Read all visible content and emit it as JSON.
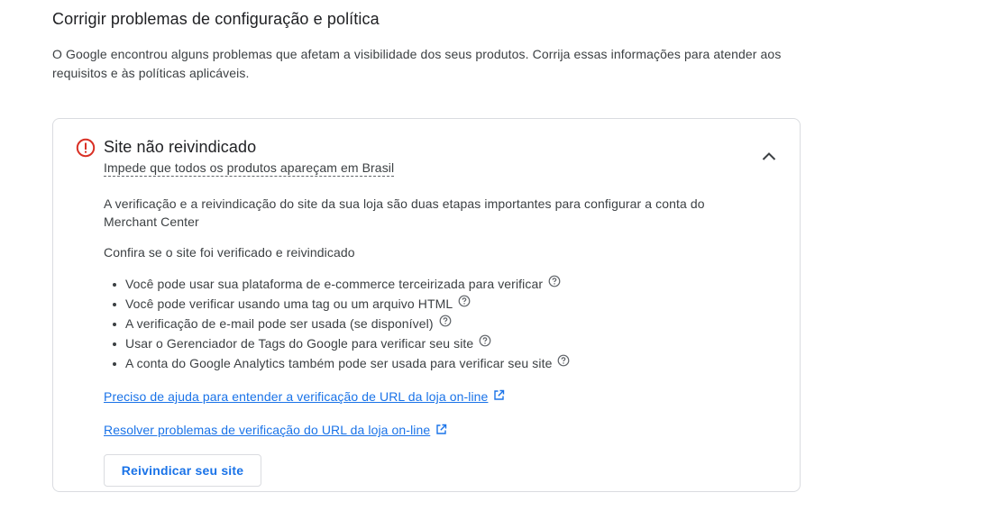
{
  "section": {
    "title": "Corrigir problemas de configuração e política",
    "description": "O Google encontrou alguns problemas que afetam a visibilidade dos seus produtos. Corrija essas informações para atender aos requisitos e às políticas aplicáveis."
  },
  "issue": {
    "icon": "error-icon",
    "status_color": "#d93025",
    "title": "Site não reivindicado",
    "subtitle": "Impede que todos os produtos apareçam em Brasil",
    "collapse_icon": "chevron-up-icon",
    "paragraph1": "A verificação e a reivindicação do site da sua loja são duas etapas importantes para configurar a conta do Merchant Center",
    "paragraph2": "Confira se o site foi verificado e reivindicado",
    "bullets": [
      "Você pode usar sua plataforma de e-commerce terceirizada para verificar",
      "Você pode verificar usando uma tag ou um arquivo HTML",
      "A verificação de e-mail pode ser usada (se disponível)",
      "Usar o Gerenciador de Tags do Google para verificar seu site",
      "A conta do Google Analytics também pode ser usada para verificar seu site"
    ],
    "bullet_icon": "help-icon",
    "links": [
      "Preciso de ajuda para entender a verificação de URL da loja on-line",
      "Resolver problemas de verificação do URL da loja on-line"
    ],
    "link_icon": "open-in-new-icon",
    "link_color": "#1a73e8",
    "button_label": "Reivindicar seu site"
  }
}
